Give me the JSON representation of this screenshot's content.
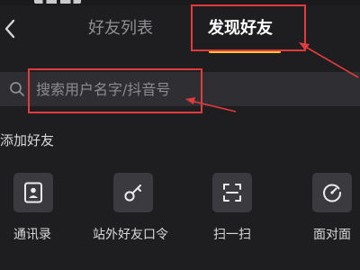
{
  "header": {
    "back_icon": "chevron-left-icon",
    "tabs": [
      {
        "label": "好友列表",
        "active": false
      },
      {
        "label": "发现好友",
        "active": true
      }
    ],
    "active_underline_color": "#f6c433"
  },
  "search": {
    "placeholder": "搜索用户名字/抖音号",
    "value": "",
    "icon": "search-icon"
  },
  "add_friends": {
    "title": "添加好友",
    "actions": [
      {
        "label": "通讯录",
        "icon": "contact-card-icon"
      },
      {
        "label": "站外好友口令",
        "icon": "key-icon"
      },
      {
        "label": "扫一扫",
        "icon": "scan-icon"
      },
      {
        "label": "面对面",
        "icon": "face-to-face-icon"
      }
    ]
  },
  "annotation_color": "#e23b3b"
}
